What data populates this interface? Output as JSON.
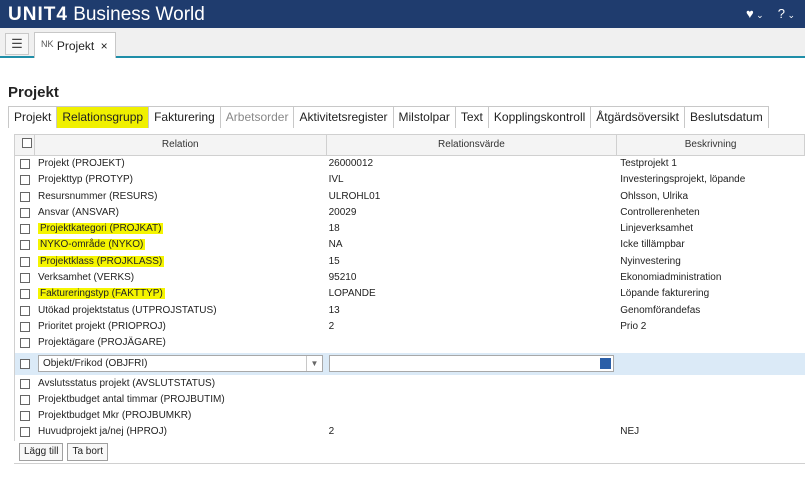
{
  "app": {
    "brand_logo": "UNIT4",
    "brand_name": "Business World",
    "icons": [
      "heart-icon",
      "chevron-down-icon",
      "help-icon",
      "chevron-down-icon"
    ]
  },
  "tabs": {
    "menu_icon": "list-icon",
    "doc_tab": {
      "prefix": "NK",
      "label": "Projekt",
      "close": "×"
    }
  },
  "page": {
    "title": "Projekt"
  },
  "subtabs": [
    {
      "label": "Projekt",
      "state": "normal"
    },
    {
      "label": "Relationsgrupp",
      "state": "active"
    },
    {
      "label": "Fakturering",
      "state": "normal"
    },
    {
      "label": "Arbetsorder",
      "state": "disabled"
    },
    {
      "label": "Aktivitetsregister",
      "state": "normal"
    },
    {
      "label": "Milstolpar",
      "state": "normal"
    },
    {
      "label": "Text",
      "state": "normal"
    },
    {
      "label": "Kopplingskontroll",
      "state": "normal"
    },
    {
      "label": "Åtgärdsöversikt",
      "state": "normal"
    },
    {
      "label": "Beslutsdatum",
      "state": "normal"
    }
  ],
  "grid": {
    "columns": [
      "Relation",
      "Relationsvärde",
      "Beskrivning"
    ],
    "rows_top": [
      {
        "relation": "Projekt (PROJEKT)",
        "value": "26000012",
        "desc": "Testprojekt 1",
        "highlight": false
      },
      {
        "relation": "Projekttyp (PROTYP)",
        "value": "IVL",
        "desc": "Investeringsprojekt, löpande",
        "highlight": false
      },
      {
        "relation": "Resursnummer (RESURS)",
        "value": "ULROHL01",
        "desc": "Ohlsson, Ulrika",
        "highlight": false
      },
      {
        "relation": "Ansvar (ANSVAR)",
        "value": "20029",
        "desc": "Controllerenheten",
        "highlight": false
      },
      {
        "relation": "Projektkategori (PROJKAT)",
        "value": "18",
        "desc": "Linjeverksamhet",
        "highlight": true
      },
      {
        "relation": "NYKO-område (NYKO)",
        "value": "NA",
        "desc": "Icke tillämpbar",
        "highlight": true
      },
      {
        "relation": "Projektklass (PROJKLASS)",
        "value": "15",
        "desc": "Nyinvestering",
        "highlight": true
      },
      {
        "relation": "Verksamhet (VERKS)",
        "value": "95210",
        "desc": "Ekonomiadministration",
        "highlight": false
      },
      {
        "relation": "Faktureringstyp (FAKTTYP)",
        "value": "LOPANDE",
        "desc": "Löpande fakturering",
        "highlight": true
      },
      {
        "relation": "Utökad projektstatus (UTPROJSTATUS)",
        "value": "13",
        "desc": "Genomförandefas",
        "highlight": false
      },
      {
        "relation": "Prioritet projekt (PRIOPROJ)",
        "value": "2",
        "desc": "Prio 2",
        "highlight": false
      },
      {
        "relation": "Projektägare (PROJÄGARE)",
        "value": "",
        "desc": "",
        "highlight": false
      }
    ],
    "edit_row": {
      "relation_value": "Objekt/Frikod (OBJFRI)",
      "value": ""
    },
    "rows_bottom": [
      {
        "relation": "Avslutsstatus projekt (AVSLUTSTATUS)",
        "value": "",
        "desc": "",
        "highlight": false
      },
      {
        "relation": "Projektbudget antal timmar (PROJBUTIM)",
        "value": "",
        "desc": "",
        "highlight": false
      },
      {
        "relation": "Projektbudget Mkr (PROJBUMKR)",
        "value": "",
        "desc": "",
        "highlight": false
      },
      {
        "relation": "Huvudprojekt ja/nej (HPROJ)",
        "value": "2",
        "desc": "NEJ",
        "highlight": false
      }
    ]
  },
  "actions": {
    "add_label": "Lägg till",
    "remove_label": "Ta bort"
  },
  "colors": {
    "topbar": "#1f3c6e",
    "highlight": "#f5f500",
    "accent": "#1f8ea8",
    "edit_row": "#dbeaf7"
  }
}
